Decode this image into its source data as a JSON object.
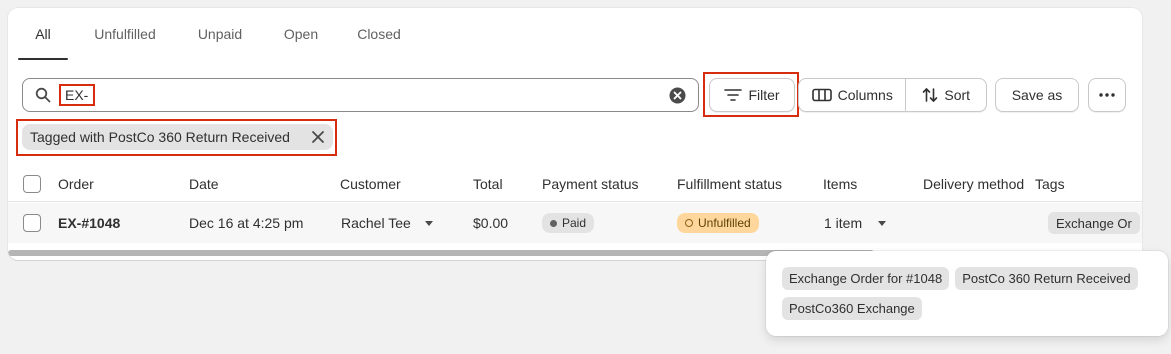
{
  "tabs": [
    {
      "label": "All",
      "active": true
    },
    {
      "label": "Unfulfilled",
      "active": false
    },
    {
      "label": "Unpaid",
      "active": false
    },
    {
      "label": "Open",
      "active": false
    },
    {
      "label": "Closed",
      "active": false
    }
  ],
  "search": {
    "value": "EX-",
    "icon": "search-icon",
    "clear_icon": "clear-circle-icon"
  },
  "toolbar": {
    "filter_label": "Filter",
    "columns_label": "Columns",
    "sort_label": "Sort",
    "save_as_label": "Save as",
    "more_icon": "more-horizontal-icon"
  },
  "applied_filter": {
    "label": "Tagged with PostCo 360 Return Received"
  },
  "table": {
    "headers": [
      "Order",
      "Date",
      "Customer",
      "Total",
      "Payment status",
      "Fulfillment status",
      "Items",
      "Delivery method",
      "Tags"
    ],
    "rows": [
      {
        "order": "EX-#1048",
        "date": "Dec 16 at 4:25 pm",
        "customer": "Rachel Tee",
        "total": "$0.00",
        "payment_status": "Paid",
        "fulfillment_status": "Unfulfilled",
        "items": "1 item",
        "delivery_method": "",
        "tags_visible": "Exchange Or"
      }
    ]
  },
  "tags_popover": {
    "tags": [
      "Exchange Order for #1048",
      "PostCo 360 Return Received",
      "PostCo360 Exchange"
    ]
  },
  "colors": {
    "highlight": "#d72c0d",
    "paid_badge": "#e3e3e3",
    "unfulfilled_badge": "#ffd79d"
  }
}
